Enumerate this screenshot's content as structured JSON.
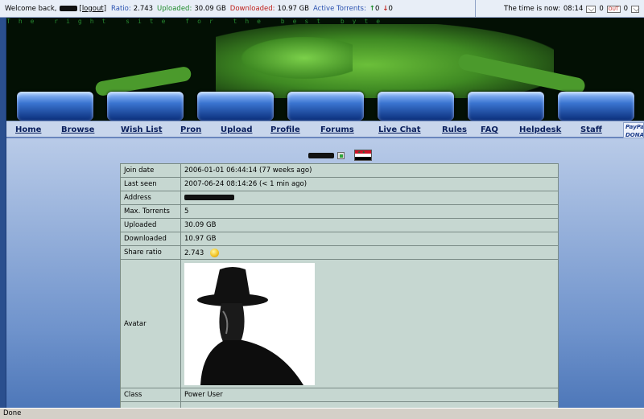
{
  "topbar": {
    "welcome": "Welcome back,",
    "logout": "[logout]",
    "ratio_label": "Ratio:",
    "ratio_value": "2.743",
    "uploaded_label": "Uploaded:",
    "uploaded_value": "30.09 GB",
    "downloaded_label": "Downloaded:",
    "downloaded_value": "10.97 GB",
    "active_label": "Active Torrents:",
    "active_seeding": "0",
    "active_leeching": "0",
    "time_label": "The time is now:",
    "time_value": "08:14",
    "inbox_count": "0",
    "outbox_count": "0"
  },
  "banner": {
    "matrix_text": "The right site for the best byte"
  },
  "nav": {
    "items": [
      "Home",
      "Browse",
      "Wish List",
      "Pron",
      "Upload",
      "Profile",
      "Forums",
      "Live Chat",
      "Rules",
      "FAQ",
      "Helpdesk",
      "Staff"
    ],
    "paypal": "PayPal DONATE"
  },
  "profile": {
    "rows": [
      {
        "key": "Join date",
        "value": "2006-01-01 06:44:14 (77 weeks ago)"
      },
      {
        "key": "Last seen",
        "value": "2007-06-24 08:14:26 (< 1 min ago)"
      },
      {
        "key": "Address",
        "value": ""
      },
      {
        "key": "Max. Torrents",
        "value": "5"
      },
      {
        "key": "Uploaded",
        "value": "30.09 GB"
      },
      {
        "key": "Downloaded",
        "value": "10.97 GB"
      },
      {
        "key": "Share ratio",
        "value": "2.743"
      },
      {
        "key": "Avatar",
        "value": ""
      },
      {
        "key": "Class",
        "value": "Power User"
      }
    ]
  },
  "statusbar": {
    "text": "Done"
  },
  "colors": {
    "nav_bg": "#c8d6ec",
    "table_bg": "#c6d7d1",
    "page_blue": "#3a66a8"
  }
}
